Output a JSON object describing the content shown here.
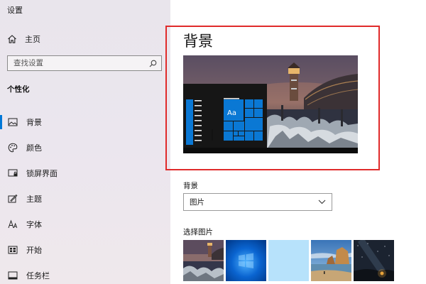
{
  "window": {
    "title": "设置"
  },
  "sidebar": {
    "home_label": "主页",
    "search_placeholder": "查找设置",
    "section_title": "个性化",
    "items": [
      {
        "label": "背景",
        "icon": "picture-icon",
        "active": true
      },
      {
        "label": "颜色",
        "icon": "palette-icon",
        "active": false
      },
      {
        "label": "锁屏界面",
        "icon": "lock-screen-icon",
        "active": false
      },
      {
        "label": "主题",
        "icon": "theme-icon",
        "active": false
      },
      {
        "label": "字体",
        "icon": "font-icon",
        "active": false
      },
      {
        "label": "开始",
        "icon": "start-grid-icon",
        "active": false
      },
      {
        "label": "任务栏",
        "icon": "taskbar-icon",
        "active": false
      }
    ]
  },
  "main": {
    "title": "背景",
    "preview_tile_text": "Aa",
    "background_label": "背景",
    "background_selected": "图片",
    "choose_picture_label": "选择图片",
    "thumbnails": [
      "lighthouse",
      "windows-blue",
      "light-blue",
      "beach-rocks",
      "night-sky"
    ]
  },
  "colors": {
    "accent": "#0078d7",
    "highlight": "#e02b2b"
  }
}
